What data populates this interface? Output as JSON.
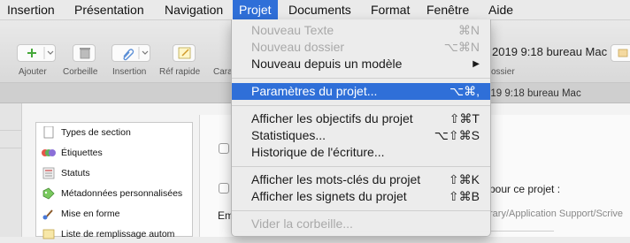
{
  "menubar": {
    "items": [
      "Insertion",
      "Présentation",
      "Navigation",
      "Projet",
      "Documents",
      "Format",
      "Fenêtre",
      "Aide"
    ]
  },
  "toolbar": {
    "buttons": [
      {
        "label": "Ajouter",
        "icon": "plus-icon"
      },
      {
        "label": "Corbeille",
        "icon": "trash-icon"
      },
      {
        "label": "Insertion",
        "icon": "paperclip-icon"
      },
      {
        "label": "Réf rapide",
        "icon": "note-icon"
      },
      {
        "label": "Cara",
        "icon": "tag-icon"
      },
      {
        "label": "ossier",
        "icon": "folder-icon"
      }
    ],
    "doc_title": "2019 9:18 bureau Mac",
    "sub_title": "019 9:18 bureau Mac"
  },
  "sidebar": {
    "items": [
      {
        "label": "Types de section",
        "icon": "page-icon"
      },
      {
        "label": "Étiquettes",
        "icon": "color-dots-icon"
      },
      {
        "label": "Statuts",
        "icon": "status-icon"
      },
      {
        "label": "Métadonnées personnalisées",
        "icon": "tag-icon"
      },
      {
        "label": "Mise en forme",
        "icon": "brush-icon"
      },
      {
        "label": "Liste de remplissage autom",
        "icon": "list-icon"
      }
    ]
  },
  "panel": {
    "text_right": "pour ce projet :",
    "label_em": "Em",
    "path": "rary/Application Support/Scrive"
  },
  "projet_menu": {
    "items": [
      {
        "label": "Nouveau Texte",
        "shortcut": "⌘N",
        "enabled": false
      },
      {
        "label": "Nouveau dossier",
        "shortcut": "⌥⌘N",
        "enabled": false
      },
      {
        "label": "Nouveau depuis un modèle",
        "shortcut": "▶",
        "enabled": true
      },
      {
        "label": "Paramètres du projet...",
        "shortcut": "⌥⌘,",
        "enabled": true,
        "highlighted": true
      },
      {
        "label": "Afficher les objectifs du projet",
        "shortcut": "⇧⌘T",
        "enabled": true
      },
      {
        "label": "Statistiques...",
        "shortcut": "⌥⇧⌘S",
        "enabled": true
      },
      {
        "label": "Historique de l'écriture...",
        "shortcut": "",
        "enabled": true
      },
      {
        "label": "Afficher les mots-clés du projet",
        "shortcut": "⇧⌘K",
        "enabled": true
      },
      {
        "label": "Afficher les signets du projet",
        "shortcut": "⇧⌘B",
        "enabled": true
      },
      {
        "label": "Vider la corbeille...",
        "shortcut": "",
        "enabled": false
      }
    ]
  },
  "colors": {
    "accent": "#2f6fd8"
  }
}
